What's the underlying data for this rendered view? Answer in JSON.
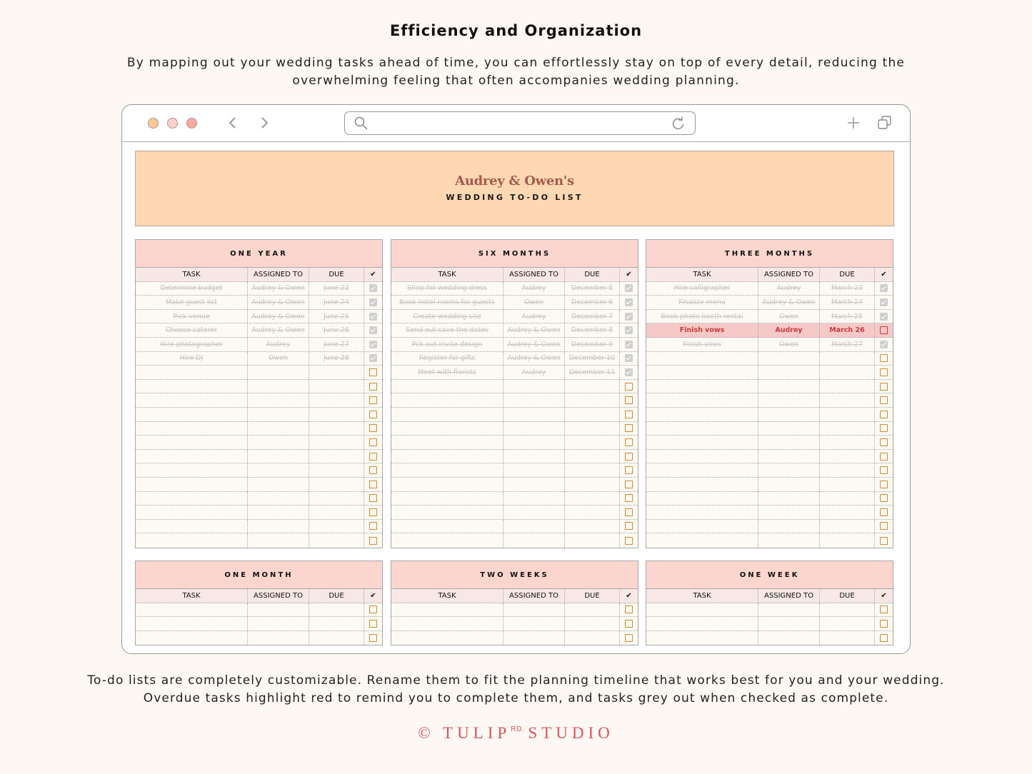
{
  "page": {
    "heading": "Efficiency and Organization",
    "intro": "By mapping out your wedding tasks ahead of time, you can effortlessly stay on top of every detail, reducing the overwhelming feeling that often accompanies wedding planning.",
    "outro_line1": "To-do lists are completely customizable. Rename them to fit the planning timeline that works best for you and your wedding.",
    "outro_line2": "Overdue tasks highlight red to remind you to complete them, and tasks grey out when checked as complete.",
    "brand_prefix": "© TULIP",
    "brand_sup": "RD.",
    "brand_suffix": "STUDIO"
  },
  "browser": {
    "window_controls": [
      "close",
      "minimize",
      "maximize"
    ],
    "icons": {
      "back": "chevron-left-icon",
      "forward": "chevron-right-icon",
      "search": "search-icon",
      "reload": "reload-icon",
      "new_tab": "plus-icon",
      "tabs": "tabs-icon"
    },
    "url_value": ""
  },
  "sheet": {
    "title": "Audrey & Owen's",
    "subtitle": "WEDDING TO-DO LIST",
    "columns": [
      "TASK",
      "ASSIGNED TO",
      "DUE",
      "✔"
    ],
    "colors": {
      "banner": "#fed7b3",
      "panel_header": "#fcd5cf",
      "overdue_bg": "#f6c9c9",
      "overdue_text": "#d0393e",
      "checkbox": "#d68a2c",
      "done_text": "#c9c5c1"
    },
    "panels": [
      {
        "title": "ONE YEAR",
        "rows": [
          {
            "task": "Determine budget",
            "assigned": "Audrey & Owen",
            "due": "June 22",
            "status": "done"
          },
          {
            "task": "Make guest list",
            "assigned": "Audrey & Owen",
            "due": "June 24",
            "status": "done"
          },
          {
            "task": "Pick venue",
            "assigned": "Audrey & Owen",
            "due": "June 25",
            "status": "done"
          },
          {
            "task": "Choose caterer",
            "assigned": "Audrey & Owen",
            "due": "June 26",
            "status": "done"
          },
          {
            "task": "Hire photographer",
            "assigned": "Audrey",
            "due": "June 27",
            "status": "done"
          },
          {
            "task": "Hire DJ",
            "assigned": "Owen",
            "due": "June 28",
            "status": "done"
          },
          {
            "task": "",
            "assigned": "",
            "due": "",
            "status": "open"
          },
          {
            "task": "",
            "assigned": "",
            "due": "",
            "status": "open"
          },
          {
            "task": "",
            "assigned": "",
            "due": "",
            "status": "open"
          },
          {
            "task": "",
            "assigned": "",
            "due": "",
            "status": "open"
          },
          {
            "task": "",
            "assigned": "",
            "due": "",
            "status": "open"
          },
          {
            "task": "",
            "assigned": "",
            "due": "",
            "status": "open"
          },
          {
            "task": "",
            "assigned": "",
            "due": "",
            "status": "open"
          },
          {
            "task": "",
            "assigned": "",
            "due": "",
            "status": "open"
          },
          {
            "task": "",
            "assigned": "",
            "due": "",
            "status": "open"
          },
          {
            "task": "",
            "assigned": "",
            "due": "",
            "status": "open"
          },
          {
            "task": "",
            "assigned": "",
            "due": "",
            "status": "open"
          },
          {
            "task": "",
            "assigned": "",
            "due": "",
            "status": "open"
          },
          {
            "task": "",
            "assigned": "",
            "due": "",
            "status": "open"
          }
        ]
      },
      {
        "title": "SIX MONTHS",
        "rows": [
          {
            "task": "Shop for wedding dress",
            "assigned": "Audrey",
            "due": "December 5",
            "status": "done"
          },
          {
            "task": "Book hotel rooms for guests",
            "assigned": "Owen",
            "due": "December 6",
            "status": "done"
          },
          {
            "task": "Create wedding site",
            "assigned": "Audrey",
            "due": "December 7",
            "status": "done"
          },
          {
            "task": "Send out save the dates",
            "assigned": "Audrey & Owen",
            "due": "December 8",
            "status": "done"
          },
          {
            "task": "Pck out invite design",
            "assigned": "Audrey & Owen",
            "due": "December 9",
            "status": "done"
          },
          {
            "task": "Register for gifts",
            "assigned": "Audrey & Owen",
            "due": "December 10",
            "status": "done"
          },
          {
            "task": "Meet with florists",
            "assigned": "Audrey",
            "due": "December 11",
            "status": "done"
          },
          {
            "task": "",
            "assigned": "",
            "due": "",
            "status": "open"
          },
          {
            "task": "",
            "assigned": "",
            "due": "",
            "status": "open"
          },
          {
            "task": "",
            "assigned": "",
            "due": "",
            "status": "open"
          },
          {
            "task": "",
            "assigned": "",
            "due": "",
            "status": "open"
          },
          {
            "task": "",
            "assigned": "",
            "due": "",
            "status": "open"
          },
          {
            "task": "",
            "assigned": "",
            "due": "",
            "status": "open"
          },
          {
            "task": "",
            "assigned": "",
            "due": "",
            "status": "open"
          },
          {
            "task": "",
            "assigned": "",
            "due": "",
            "status": "open"
          },
          {
            "task": "",
            "assigned": "",
            "due": "",
            "status": "open"
          },
          {
            "task": "",
            "assigned": "",
            "due": "",
            "status": "open"
          },
          {
            "task": "",
            "assigned": "",
            "due": "",
            "status": "open"
          },
          {
            "task": "",
            "assigned": "",
            "due": "",
            "status": "open"
          }
        ]
      },
      {
        "title": "THREE MONTHS",
        "rows": [
          {
            "task": "Hire calligrapher",
            "assigned": "Audrey",
            "due": "March 23",
            "status": "done"
          },
          {
            "task": "Finalize menu",
            "assigned": "Audrey & Owen",
            "due": "March 24",
            "status": "done"
          },
          {
            "task": "Book photo booth rental",
            "assigned": "Owen",
            "due": "March 25",
            "status": "done"
          },
          {
            "task": "Finish vows",
            "assigned": "Audrey",
            "due": "March 26",
            "status": "overdue"
          },
          {
            "task": "Finish vows",
            "assigned": "Owen",
            "due": "March 27",
            "status": "done"
          },
          {
            "task": "",
            "assigned": "",
            "due": "",
            "status": "open"
          },
          {
            "task": "",
            "assigned": "",
            "due": "",
            "status": "open"
          },
          {
            "task": "",
            "assigned": "",
            "due": "",
            "status": "open"
          },
          {
            "task": "",
            "assigned": "",
            "due": "",
            "status": "open"
          },
          {
            "task": "",
            "assigned": "",
            "due": "",
            "status": "open"
          },
          {
            "task": "",
            "assigned": "",
            "due": "",
            "status": "open"
          },
          {
            "task": "",
            "assigned": "",
            "due": "",
            "status": "open"
          },
          {
            "task": "",
            "assigned": "",
            "due": "",
            "status": "open"
          },
          {
            "task": "",
            "assigned": "",
            "due": "",
            "status": "open"
          },
          {
            "task": "",
            "assigned": "",
            "due": "",
            "status": "open"
          },
          {
            "task": "",
            "assigned": "",
            "due": "",
            "status": "open"
          },
          {
            "task": "",
            "assigned": "",
            "due": "",
            "status": "open"
          },
          {
            "task": "",
            "assigned": "",
            "due": "",
            "status": "open"
          },
          {
            "task": "",
            "assigned": "",
            "due": "",
            "status": "open"
          }
        ]
      },
      {
        "title": "ONE MONTH",
        "rows": [
          {
            "task": "",
            "assigned": "",
            "due": "",
            "status": "open"
          },
          {
            "task": "",
            "assigned": "",
            "due": "",
            "status": "open"
          },
          {
            "task": "",
            "assigned": "",
            "due": "",
            "status": "open"
          }
        ]
      },
      {
        "title": "TWO WEEKS",
        "rows": [
          {
            "task": "",
            "assigned": "",
            "due": "",
            "status": "open"
          },
          {
            "task": "",
            "assigned": "",
            "due": "",
            "status": "open"
          },
          {
            "task": "",
            "assigned": "",
            "due": "",
            "status": "open"
          }
        ]
      },
      {
        "title": "ONE WEEK",
        "rows": [
          {
            "task": "",
            "assigned": "",
            "due": "",
            "status": "open"
          },
          {
            "task": "",
            "assigned": "",
            "due": "",
            "status": "open"
          },
          {
            "task": "",
            "assigned": "",
            "due": "",
            "status": "open"
          }
        ]
      }
    ]
  }
}
